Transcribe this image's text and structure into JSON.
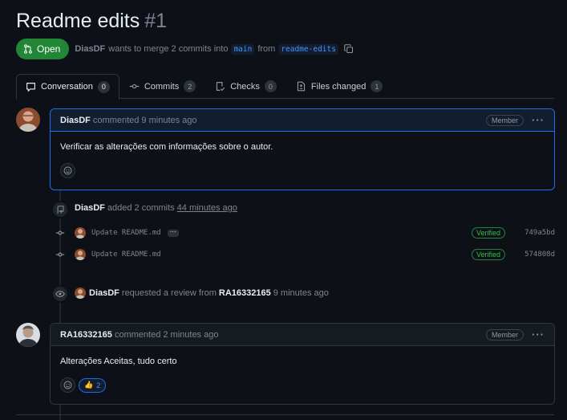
{
  "pr": {
    "title": "Readme edits",
    "number": "#1",
    "state": "Open",
    "author": "DiasDF",
    "merge_text": "wants to merge 2 commits into",
    "base_branch": "main",
    "from_text": "from",
    "head_branch": "readme-edits"
  },
  "tabs": [
    {
      "label": "Conversation",
      "count": "0"
    },
    {
      "label": "Commits",
      "count": "2"
    },
    {
      "label": "Checks",
      "count": "0"
    },
    {
      "label": "Files changed",
      "count": "1"
    }
  ],
  "comment1": {
    "author": "DiasDF",
    "action": "commented 9 minutes ago",
    "role": "Member",
    "body": "Verificar as alterações com informações sobre o autor."
  },
  "commits_event": {
    "author": "DiasDF",
    "text": "added 2 commits",
    "time": "44 minutes ago",
    "commits": [
      {
        "message": "Update README.md",
        "verified": "Verified",
        "sha": "749a5bd"
      },
      {
        "message": "Update README.md",
        "verified": "Verified",
        "sha": "574808d"
      }
    ]
  },
  "review_event": {
    "author": "DiasDF",
    "text": "requested a review from",
    "reviewer": "RA16332165",
    "time": "9 minutes ago"
  },
  "comment2": {
    "author": "RA16332165",
    "action": "commented 2 minutes ago",
    "role": "Member",
    "body": "Alterações Aceitas, tudo certo",
    "reaction_emoji": "👍",
    "reaction_count": "2"
  },
  "colors": {
    "background": "#0d1117",
    "open_green": "#238636",
    "accent_blue": "#1f6feb",
    "verified_green": "#3fb950"
  }
}
